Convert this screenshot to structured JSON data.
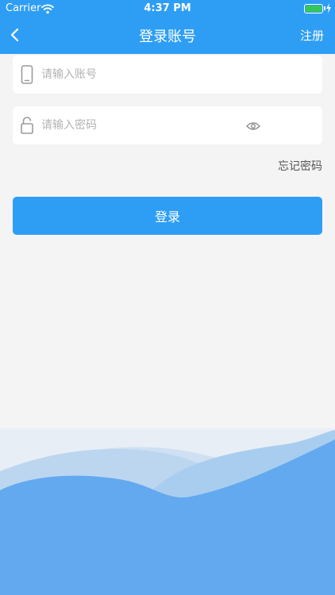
{
  "status_bar": {
    "carrier": "Carrier",
    "time": "4:37 PM"
  },
  "nav": {
    "title": "登录账号",
    "register_label": "注册"
  },
  "form": {
    "account_placeholder": "请输入账号",
    "password_placeholder": "请输入密码",
    "forgot_label": "忘记密码",
    "login_label": "登录"
  },
  "colors": {
    "primary": "#2e9ef4",
    "background": "#f4f4f4",
    "battery": "#34c759"
  },
  "icons": [
    "back-chevron-icon",
    "wifi-icon",
    "battery-icon",
    "phone-icon",
    "lock-icon",
    "eye-icon"
  ]
}
